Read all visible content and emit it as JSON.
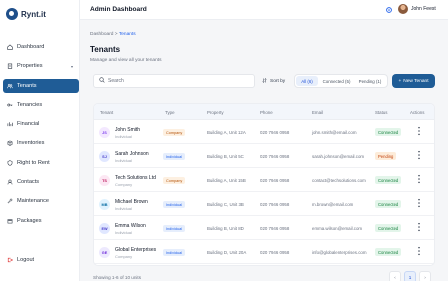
{
  "app": {
    "logo_text": "Rynt.it",
    "page_heading": "Admin Dashboard"
  },
  "user": {
    "name": "John Feest"
  },
  "sidebar": {
    "items": [
      {
        "label": "Dashboard",
        "icon": "home-icon"
      },
      {
        "label": "Properties",
        "icon": "building-icon",
        "caret": "▾"
      },
      {
        "label": "Tenants",
        "icon": "users-icon"
      },
      {
        "label": "Tenancies",
        "icon": "key-icon"
      },
      {
        "label": "Financial",
        "icon": "chart-icon"
      },
      {
        "label": "Inventories",
        "icon": "box-icon"
      },
      {
        "label": "Right to Rent",
        "icon": "shield-icon"
      },
      {
        "label": "Contacts",
        "icon": "contact-icon"
      },
      {
        "label": "Maintenance",
        "icon": "wrench-icon"
      },
      {
        "label": "Packages",
        "icon": "package-icon"
      }
    ],
    "logout": "Logout"
  },
  "breadcrumb": {
    "parent": "Dashboard",
    "separator": " > ",
    "current": "Tenants"
  },
  "page": {
    "title": "Tenants",
    "subtitle": "Manage and view all your tenants"
  },
  "toolbar": {
    "search_placeholder": "Search",
    "sort_label": "Sort by",
    "filters": [
      {
        "label": "All (6)",
        "active": true
      },
      {
        "label": "Connected (5)",
        "active": false
      },
      {
        "label": "Pending (1)",
        "active": false
      }
    ],
    "new_button": "New Tenant"
  },
  "table": {
    "columns": [
      "Tenant",
      "Type",
      "Property",
      "Phone",
      "Email",
      "Status",
      "Actions"
    ],
    "rows": [
      {
        "initials": "JS",
        "name": "John Smith",
        "kind": "Individual",
        "type": "Company",
        "property": "Building A, Unit 12A",
        "phone": "020 7946 0958",
        "email": "john.smith@email.com",
        "status": "Connected"
      },
      {
        "initials": "SJ",
        "name": "Sarah Johnson",
        "kind": "Individual",
        "type": "Individual",
        "property": "Building B, Unit 5C",
        "phone": "020 7946 0958",
        "email": "sarah.johnson@email.com",
        "status": "Pending"
      },
      {
        "initials": "TS",
        "name": "Tech Solutions Ltd",
        "kind": "Company",
        "type": "Company",
        "property": "Building A, Unit 15B",
        "phone": "020 7946 0958",
        "email": "contact@techsolutions.com",
        "status": "Connected"
      },
      {
        "initials": "MB",
        "name": "Michael Brown",
        "kind": "Individual",
        "type": "Individual",
        "property": "Building C, Unit 3B",
        "phone": "020 7946 0958",
        "email": "m.brown@email.com",
        "status": "Connected"
      },
      {
        "initials": "EW",
        "name": "Emma Wilson",
        "kind": "Individual",
        "type": "Individual",
        "property": "Building B, Unit 8D",
        "phone": "020 7946 0958",
        "email": "emma.wilson@email.com",
        "status": "Connected"
      },
      {
        "initials": "GE",
        "name": "Global Enterprises",
        "kind": "Company",
        "type": "Individual",
        "property": "Building D, Unit 20A",
        "phone": "020 7946 0958",
        "email": "info@globalenterprises.com",
        "status": "Connected"
      }
    ]
  },
  "footer": {
    "showing": "Showing 1-6 of 10 units",
    "prev": "‹",
    "page": "1",
    "next": "›"
  },
  "colors": {
    "primary": "#1f5c96",
    "connected": "#15803d",
    "pending": "#c2410c"
  }
}
